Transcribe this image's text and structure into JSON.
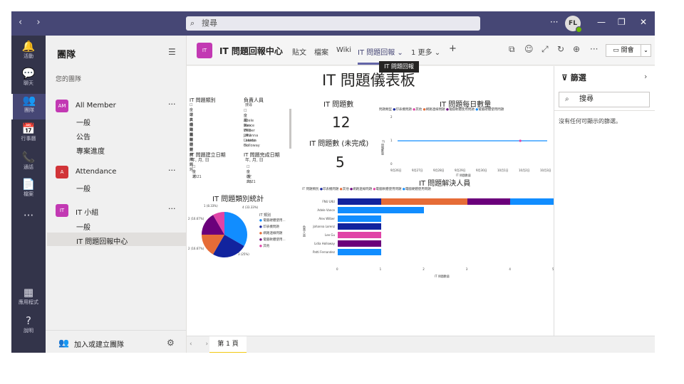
{
  "search": {
    "placeholder": "搜尋"
  },
  "window": {
    "more": "···",
    "avatar": "FL",
    "minimize": "—",
    "restore": "❐",
    "close": "✕"
  },
  "rail": [
    {
      "icon": "🔔",
      "label": "活動"
    },
    {
      "icon": "💬",
      "label": "聊天"
    },
    {
      "icon": "👥",
      "label": "團隊"
    },
    {
      "icon": "📅",
      "label": "行事曆"
    },
    {
      "icon": "📞",
      "label": "通話"
    },
    {
      "icon": "📄",
      "label": "檔案"
    },
    {
      "icon": "···",
      "label": ""
    },
    {
      "icon": "▦",
      "label": "應用程式"
    },
    {
      "icon": "?",
      "label": "說明"
    }
  ],
  "teams": {
    "header": "團隊",
    "section": "您的團隊",
    "list": [
      {
        "initials": "AM",
        "name": "All Member",
        "color": "#c239b3",
        "channels": [
          "一般",
          "公告",
          "專案進度"
        ]
      },
      {
        "initials": "A",
        "name": "Attendance",
        "color": "#d13438",
        "channels": [
          "一般"
        ]
      },
      {
        "initials": "IT",
        "name": "IT 小組",
        "color": "#c239b3",
        "channels": [
          "一般",
          "IT 問題回報中心"
        ]
      }
    ],
    "menu": "···",
    "join": "加入或建立團隊"
  },
  "tabbar": {
    "title": "IT 問題回報中心",
    "tabs": [
      "貼文",
      "檔案",
      "Wiki",
      "IT 問題回報 ⌄",
      "1 更多 ⌄",
      "+"
    ],
    "meet": "開會",
    "tooltip": "IT 問題回報"
  },
  "report": {
    "title": "IT 問題儀表板",
    "slicer_category": {
      "title": "IT 問題類別",
      "items": [
        "全選",
        "印表機問題",
        "其他",
        "網路連線問題",
        "電腦軟體使用問題",
        "電腦硬體使用問題"
      ]
    },
    "slicer_owner": {
      "title": "負責人員",
      "search": "搜尋",
      "items": [
        "全選",
        "Adele Vance",
        "Alex Wilber",
        "FNU LNU",
        "Johanna Lorenz",
        "Lee Gu",
        "Lidia Holloway"
      ]
    },
    "slicer_created": {
      "title": "IT 問題建立日期",
      "sub": "年, 月, 日",
      "items": [
        "全選",
        "2021"
      ]
    },
    "slicer_done": {
      "title": "IT 問題完成日期",
      "sub": "年, 月, 日",
      "items": [
        "全選",
        "(空白)",
        "2021"
      ]
    },
    "kpi1": {
      "title": "IT 問題數",
      "value": "12"
    },
    "kpi2": {
      "title": "IT 問題數 (未完成)",
      "value": "5"
    },
    "pie_title": "IT 問題類別統計",
    "daily_title": "IT 問題每日數量",
    "resolver_title": "IT 問題解決人員"
  },
  "chart_data": [
    {
      "type": "pie",
      "title": "IT 問題類別統計",
      "legend_title": "IT 類別",
      "slices": [
        {
          "name": "電腦硬體使用...",
          "value": 4,
          "label": "4 (33.33%)",
          "color": "#118dff"
        },
        {
          "name": "印表機問題",
          "value": 3,
          "label": "3 (25%)",
          "color": "#12239e"
        },
        {
          "name": "網路連線問題",
          "value": 2,
          "label": "2 (16.67%)",
          "color": "#e66c37"
        },
        {
          "name": "電腦軟體使用...",
          "value": 2,
          "label": "2 (16.67%)",
          "color": "#6b007b"
        },
        {
          "name": "其他",
          "value": 1,
          "label": "1 (8.33%)",
          "color": "#e044a7"
        }
      ]
    },
    {
      "type": "line",
      "title": "IT 問題每日數量",
      "legend_title": "問題類型",
      "legend": [
        {
          "name": "印表機問題",
          "color": "#12239e"
        },
        {
          "name": "其他",
          "color": "#e044a7"
        },
        {
          "name": "網路連線問題",
          "color": "#e66c37"
        },
        {
          "name": "電腦軟體使用問題",
          "color": "#6b007b"
        },
        {
          "name": "電腦硬體使用問題",
          "color": "#118dff"
        }
      ],
      "x": [
        "9月26日",
        "9月27日",
        "9月28日",
        "9月29日",
        "9月30日",
        "10月1日",
        "10月2日",
        "10月3日"
      ],
      "y": [
        1,
        1,
        1,
        1,
        1,
        1,
        1,
        1
      ],
      "ylim": [
        0,
        2
      ],
      "yticks": [
        "2",
        "1",
        "0"
      ],
      "xlabel": "IT 問題數量",
      "ylabel": "IT 問題數量"
    },
    {
      "type": "bar",
      "title": "IT 問題解決人員",
      "legend_title": "IT 問題類別",
      "legend": [
        {
          "name": "印表機問題",
          "color": "#12239e"
        },
        {
          "name": "其他",
          "color": "#e66c37"
        },
        {
          "name": "網路連線問題",
          "color": "#6b007b"
        },
        {
          "name": "電腦軟體使用問題",
          "color": "#e044a7"
        },
        {
          "name": "電腦硬體使用問題",
          "color": "#118dff"
        }
      ],
      "categories": [
        "FNU LNU",
        "Adele Vance",
        "Alex Wilber",
        "Johanna Lorenz",
        "Lee Gu",
        "Lidia Holloway",
        "Patti Fernandez"
      ],
      "stacks": [
        [
          {
            "v": 1,
            "c": "#12239e"
          },
          {
            "v": 2,
            "c": "#e66c37"
          },
          {
            "v": 1,
            "c": "#6b007b"
          },
          {
            "v": 1,
            "c": "#118dff"
          }
        ],
        [
          {
            "v": 2,
            "c": "#118dff"
          }
        ],
        [
          {
            "v": 1,
            "c": "#118dff"
          }
        ],
        [
          {
            "v": 1,
            "c": "#12239e"
          }
        ],
        [
          {
            "v": 1,
            "c": "#e044a7"
          }
        ],
        [
          {
            "v": 1,
            "c": "#6b007b"
          }
        ],
        [
          {
            "v": 1,
            "c": "#118dff"
          }
        ]
      ],
      "xlim": [
        0,
        5
      ],
      "xticks": [
        "0",
        "1",
        "2",
        "3",
        "4",
        "5"
      ],
      "xlabel": "IT 問題數量",
      "ylabel": "負責人員"
    }
  ],
  "pagebar": {
    "page": "第 1 頁",
    "nav": "‹ ›"
  },
  "filters": {
    "title": "篩選",
    "search": "搜尋",
    "empty": "沒有任何可顯示的篩選。"
  }
}
